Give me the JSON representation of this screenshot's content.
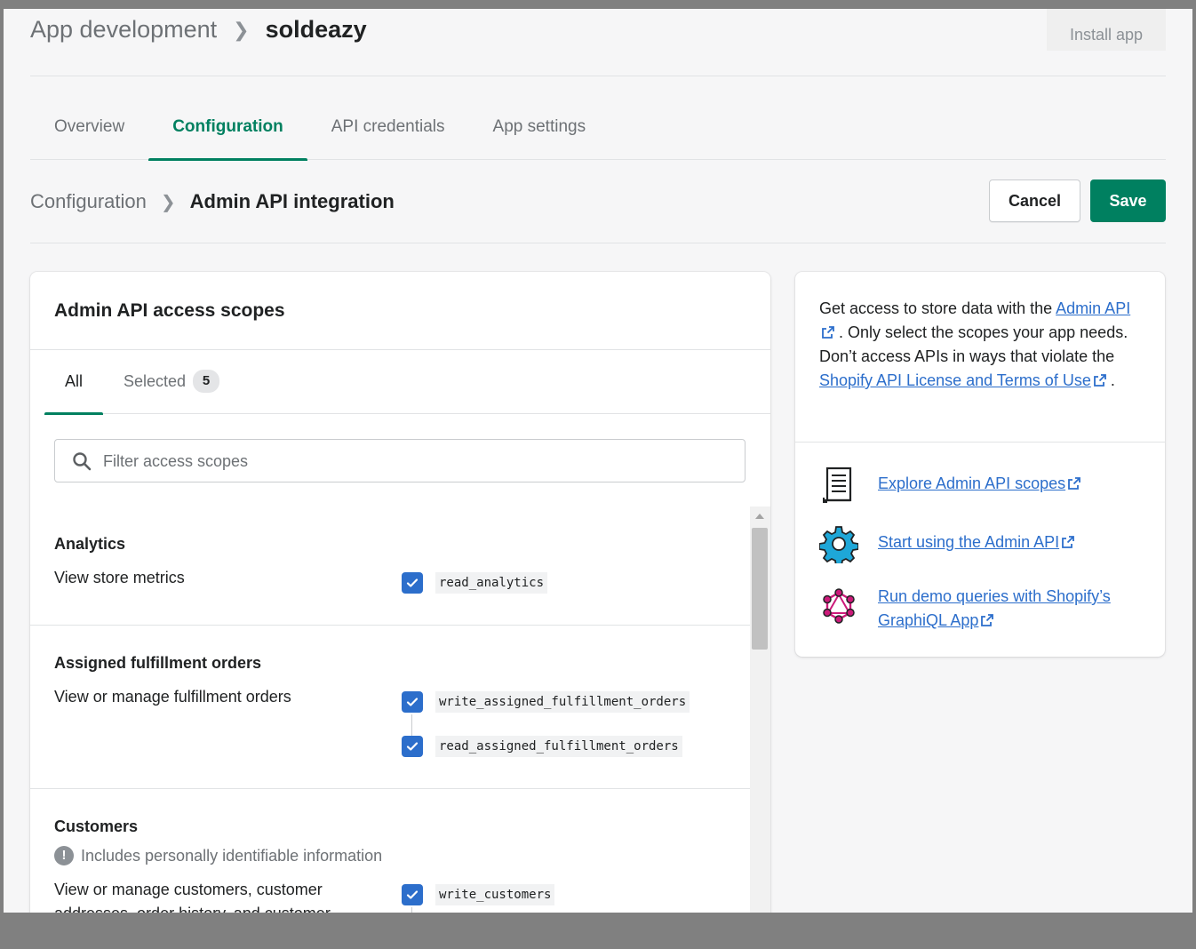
{
  "header": {
    "breadcrumb_parent": "App development",
    "breadcrumb_current": "soldeazy",
    "install_label": "Install app"
  },
  "tabs": [
    {
      "label": "Overview"
    },
    {
      "label": "Configuration"
    },
    {
      "label": "API credentials"
    },
    {
      "label": "App settings"
    }
  ],
  "subheader": {
    "breadcrumb_parent": "Configuration",
    "breadcrumb_current": "Admin API integration",
    "cancel_label": "Cancel",
    "save_label": "Save"
  },
  "scopes_card": {
    "title": "Admin API access scopes",
    "tab_all": "All",
    "tab_selected": "Selected",
    "selected_count": "5",
    "search_placeholder": "Filter access scopes",
    "groups": [
      {
        "title": "Analytics",
        "description": "View store metrics",
        "scopes": [
          "read_analytics"
        ]
      },
      {
        "title": "Assigned fulfillment orders",
        "description": "View or manage fulfillment orders",
        "scopes": [
          "write_assigned_fulfillment_orders",
          "read_assigned_fulfillment_orders"
        ]
      },
      {
        "title": "Customers",
        "pii_note": "Includes personally identifiable information",
        "description": "View or manage customers, customer addresses, order history, and customer",
        "scopes": [
          "write_customers"
        ]
      }
    ]
  },
  "info_card": {
    "text_1": "Get access to store data with the",
    "link_admin_api": "Admin API",
    "text_2": ". Only select the scopes your app needs. Don’t access APIs in ways that violate the",
    "link_license": "Shopify API License and Terms of Use",
    "text_3": ".",
    "resources": [
      {
        "label": "Explore Admin API scopes",
        "icon": "document-scroll-icon"
      },
      {
        "label": "Start using the Admin API",
        "icon": "gear-icon"
      },
      {
        "label": "Run demo queries with Shopify’s GraphiQL App",
        "icon": "graphql-icon"
      }
    ]
  },
  "colors": {
    "accent_green": "#008060",
    "link_blue": "#2c6ecb",
    "checkbox_blue": "#2c6ecb",
    "gear_blue": "#1ea7d8",
    "graphql_pink": "#cc1a7a"
  }
}
